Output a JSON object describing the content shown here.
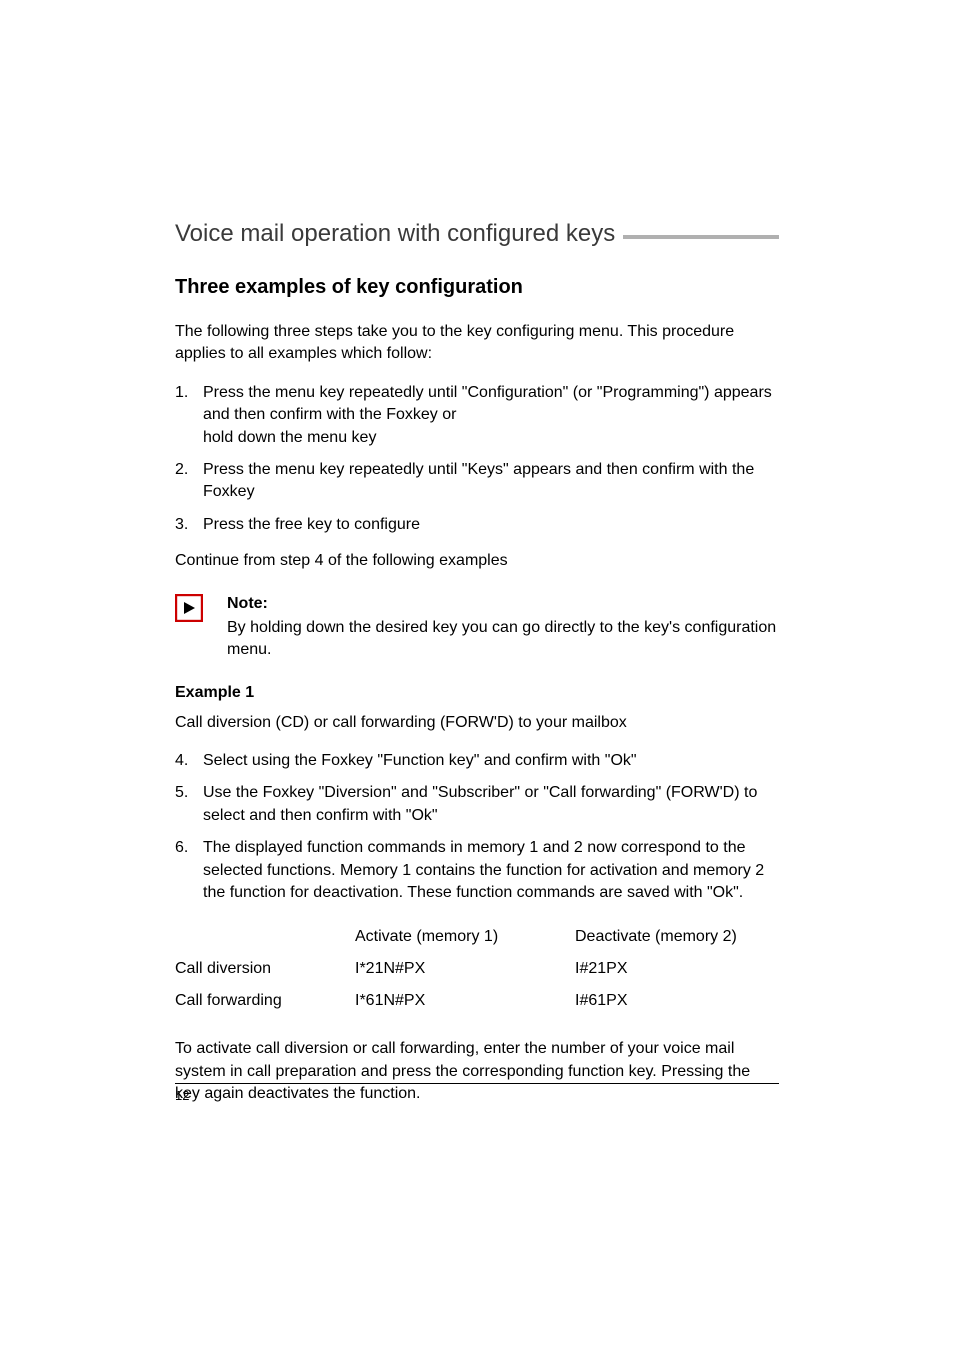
{
  "header": {
    "title": "Voice mail operation with configured keys"
  },
  "subheading": "Three examples of key configuration",
  "intro": "The following three steps take you to the key configuring menu. This procedure applies to all examples which follow:",
  "steps_a": [
    {
      "num": "1.",
      "text": "Press the menu key repeatedly until \"Configuration\" (or \"Programming\") appears and then confirm with the Foxkey or\nhold down the menu key"
    },
    {
      "num": "2.",
      "text": "Press the menu key repeatedly until \"Keys\" appears and then confirm with the Foxkey"
    },
    {
      "num": "3.",
      "text": "Press the free key to configure"
    }
  ],
  "continue_line": "Continue from step 4 of the following examples",
  "note": {
    "label": "Note:",
    "text": "By holding down the desired key you can go directly to the key's configuration menu."
  },
  "example": {
    "label": "Example 1",
    "desc": "Call diversion (CD) or call forwarding (FORW'D) to your mailbox"
  },
  "steps_b": [
    {
      "num": "4.",
      "text": "Select using the Foxkey \"Function key\" and confirm with \"Ok\""
    },
    {
      "num": "5.",
      "text": "Use the Foxkey \"Diversion\" and \"Subscriber\" or \"Call forwarding\" (FORW'D) to select and then confirm with \"Ok\""
    },
    {
      "num": "6.",
      "text": "The displayed function commands in memory 1 and 2 now correspond to the selected functions. Memory 1 contains the function for activation and memory 2 the function for deactivation. These function commands are saved with \"Ok\"."
    }
  ],
  "table": {
    "headers": {
      "col1": "Activate (memory 1)",
      "col2": "Deactivate (memory 2)"
    },
    "rows": [
      {
        "label": "Call diversion",
        "col1": "I*21N#PX",
        "col2": "I#21PX"
      },
      {
        "label": "Call forwarding",
        "col1": "I*61N#PX",
        "col2": "I#61PX"
      }
    ]
  },
  "closing": "To activate call diversion or call forwarding, enter the number of your voice mail system in call preparation and press the corresponding function key. Pressing the key again deactivates the function.",
  "footer": {
    "page": "12"
  }
}
